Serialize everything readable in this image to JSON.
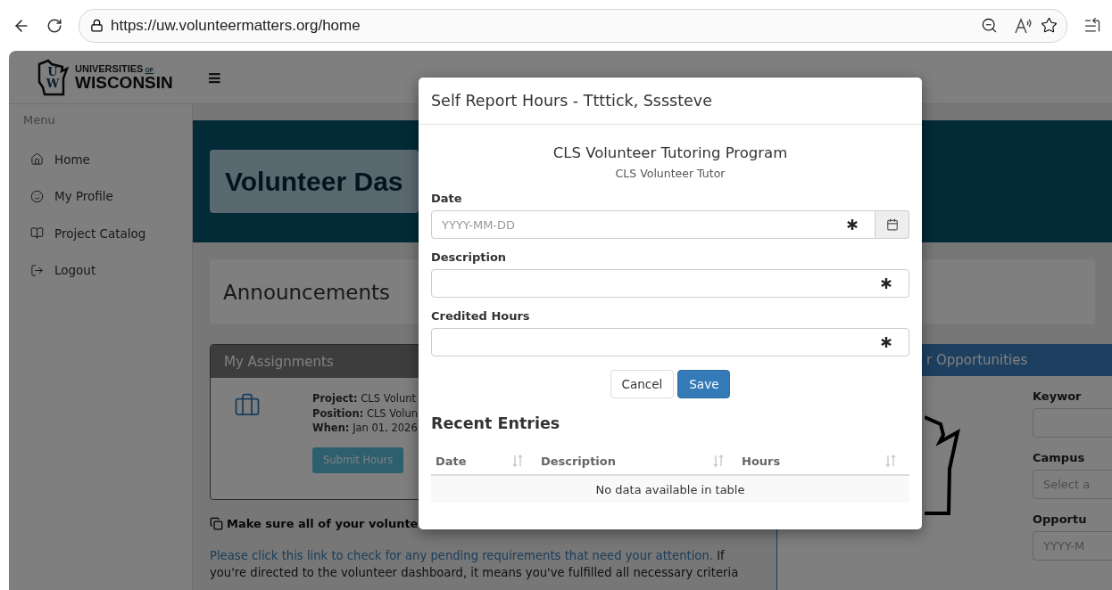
{
  "browser": {
    "url": "https://uw.volunteermatters.org/home"
  },
  "header": {
    "logo_letters": [
      "U",
      "W"
    ],
    "logo_line1": "UNIVERSITIES",
    "logo_of": "OF",
    "logo_line2": "WISCONSIN",
    "menu_icon": "≡"
  },
  "sidebar": {
    "heading": "Menu",
    "items": [
      {
        "label": "Home",
        "kind": "home"
      },
      {
        "label": "My Profile",
        "kind": "profile"
      },
      {
        "label": "Project Catalog",
        "kind": "catalog"
      },
      {
        "label": "Logout",
        "kind": "logout"
      }
    ]
  },
  "banner": {
    "title": "Volunteer Das"
  },
  "announcements": {
    "title": "Announcements"
  },
  "assignments": {
    "title": "My Assignments",
    "details": [
      {
        "label": "Project:",
        "value": "CLS Volunt"
      },
      {
        "label": "Position:",
        "value": "CLS Volun"
      },
      {
        "label": "When:",
        "value": "Jan 01, 2026"
      }
    ],
    "button": "Submit Hours"
  },
  "notice": {
    "title": "Make sure all of your volunte",
    "link": "Please click this link to check for any pending requirements that need your attention.",
    "text": " If you're directed to the volunteer dashboard, it means you've fulfilled all necessary criteria"
  },
  "opportunities": {
    "title": "r Opportunities",
    "fields": [
      {
        "label": "Keywor"
      },
      {
        "label": "Campus",
        "placeholder": "Select a"
      },
      {
        "label": "Opportu",
        "placeholder": "YYYY-M"
      }
    ]
  },
  "modal": {
    "title": "Self Report Hours - Ttttick, Ssssteve",
    "program": "CLS Volunteer Tutoring Program",
    "position": "CLS Volunteer Tutor",
    "fields": [
      {
        "label": "Date",
        "placeholder": "YYYY-MM-DD",
        "required": true,
        "calendar": true
      },
      {
        "label": "Description",
        "required": true,
        "calendar": false
      },
      {
        "label": "Credited Hours",
        "required": true,
        "calendar": false
      }
    ],
    "buttons": [
      {
        "label": "Cancel",
        "kind": "default"
      },
      {
        "label": "Save",
        "kind": "primary"
      }
    ],
    "recent": {
      "title": "Recent Entries",
      "columns": [
        "Date",
        "Description",
        "Hours"
      ],
      "empty": "No data available in table"
    }
  }
}
